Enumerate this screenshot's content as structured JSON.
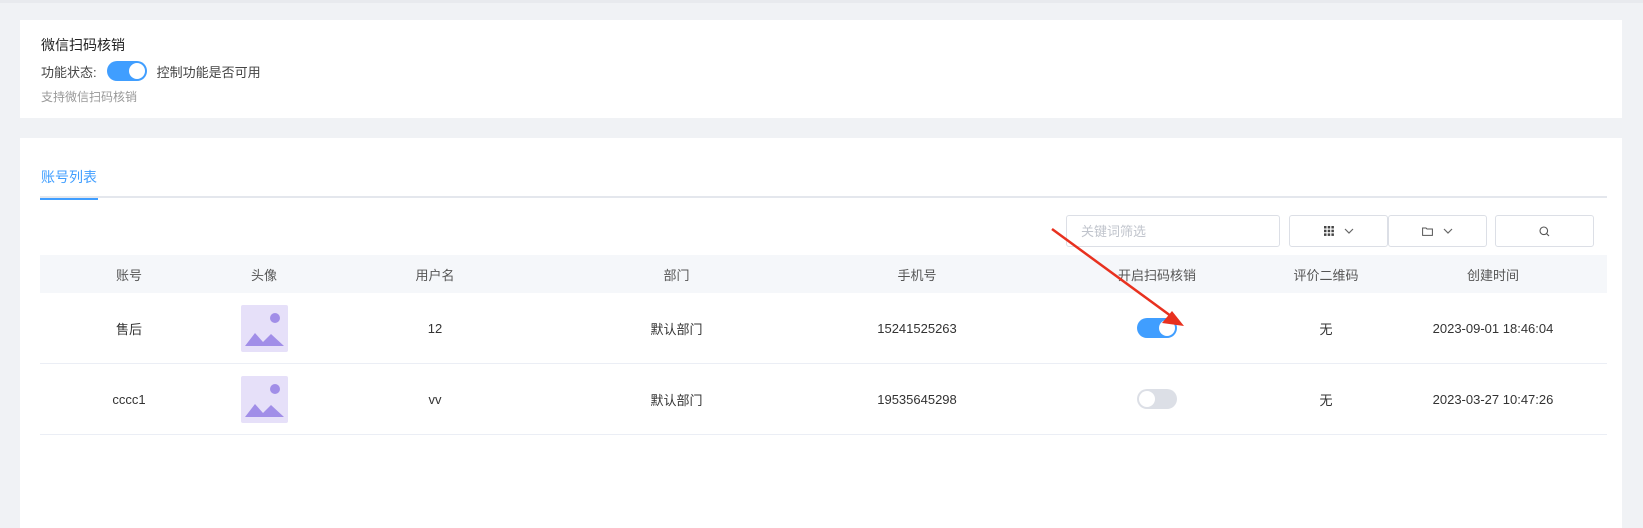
{
  "feature": {
    "title": "微信扫码核销",
    "status_label": "功能状态:",
    "status_desc": "控制功能是否可用",
    "hint": "支持微信扫码核销",
    "enabled": true
  },
  "tabs": [
    {
      "label": "账号列表",
      "active": true
    }
  ],
  "toolbar": {
    "search_placeholder": "关键词筛选",
    "columns_icon": "grid-icon",
    "folder_icon": "folder-icon",
    "search_icon": "search-icon"
  },
  "table": {
    "headers": [
      "账号",
      "头像",
      "用户名",
      "部门",
      "手机号",
      "开启扫码核销",
      "评价二维码",
      "创建时间"
    ],
    "rows": [
      {
        "account": "售后",
        "username": "12",
        "department": "默认部门",
        "phone": "15241525263",
        "scan_enabled": true,
        "qr": "无",
        "created": "2023-09-01 18:46:04"
      },
      {
        "account": "cccc1",
        "username": "vv",
        "department": "默认部门",
        "phone": "19535645298",
        "scan_enabled": false,
        "qr": "无",
        "created": "2023-03-27 10:47:26"
      }
    ]
  },
  "colors": {
    "accent": "#409eff",
    "arrow": "#e8311f",
    "avatar_bg": "#e6e0f9",
    "avatar_fg": "#a18ee8"
  }
}
